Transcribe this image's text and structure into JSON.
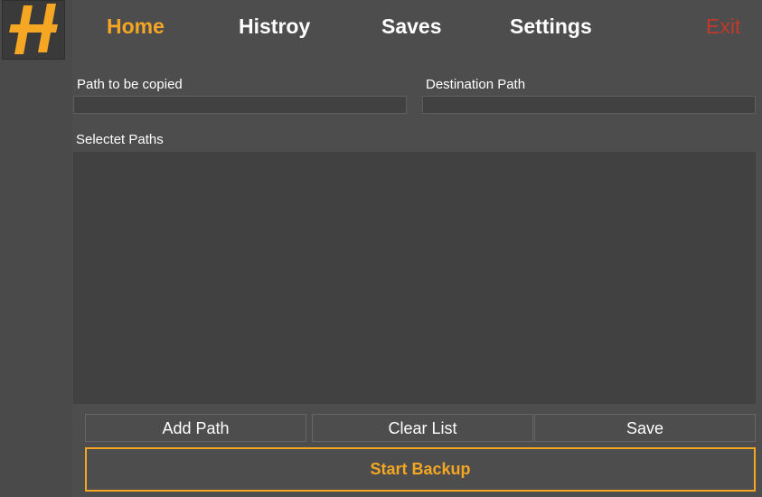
{
  "colors": {
    "accent": "#f5a623",
    "exit": "#c0392b",
    "background": "#4d4d4d",
    "panel": "#414141"
  },
  "logo": {
    "icon": "app-logo-icon"
  },
  "nav": {
    "home": "Home",
    "history": "Histroy",
    "saves": "Saves",
    "settings": "Settings",
    "exit": "Exit",
    "active": "home"
  },
  "form": {
    "source_label": "Path to be copied",
    "source_value": "",
    "destination_label": "Destination Path",
    "destination_value": "",
    "selected_label": "Selectet Paths",
    "selected_paths": []
  },
  "actions": {
    "add_path": "Add Path",
    "clear_list": "Clear List",
    "save": "Save",
    "start_backup": "Start Backup"
  }
}
